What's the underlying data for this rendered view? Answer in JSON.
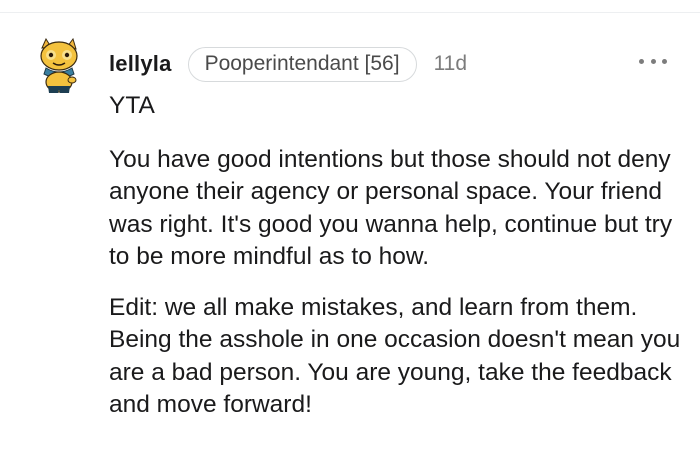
{
  "comment": {
    "author": "lellyla",
    "flair": "Pooperintendant [56]",
    "age": "11d",
    "more_icon": "more-horizontal-icon",
    "avatar_icon": "avatar-snoo-icon",
    "paragraphs": [
      "YTA",
      "You have good intentions but those should not deny anyone their agency or personal space. Your friend was right. It's good you wanna help, continue but try to be more mindful as to how.",
      "Edit: we all make mistakes, and learn from them. Being the asshole in one occasion doesn't mean you are a bad person. You are young, take the feedback and move forward!"
    ]
  },
  "colors": {
    "text": "#1a1a1b",
    "meta": "#7c7c7c",
    "border": "#d7dadc",
    "background": "#ffffff"
  }
}
